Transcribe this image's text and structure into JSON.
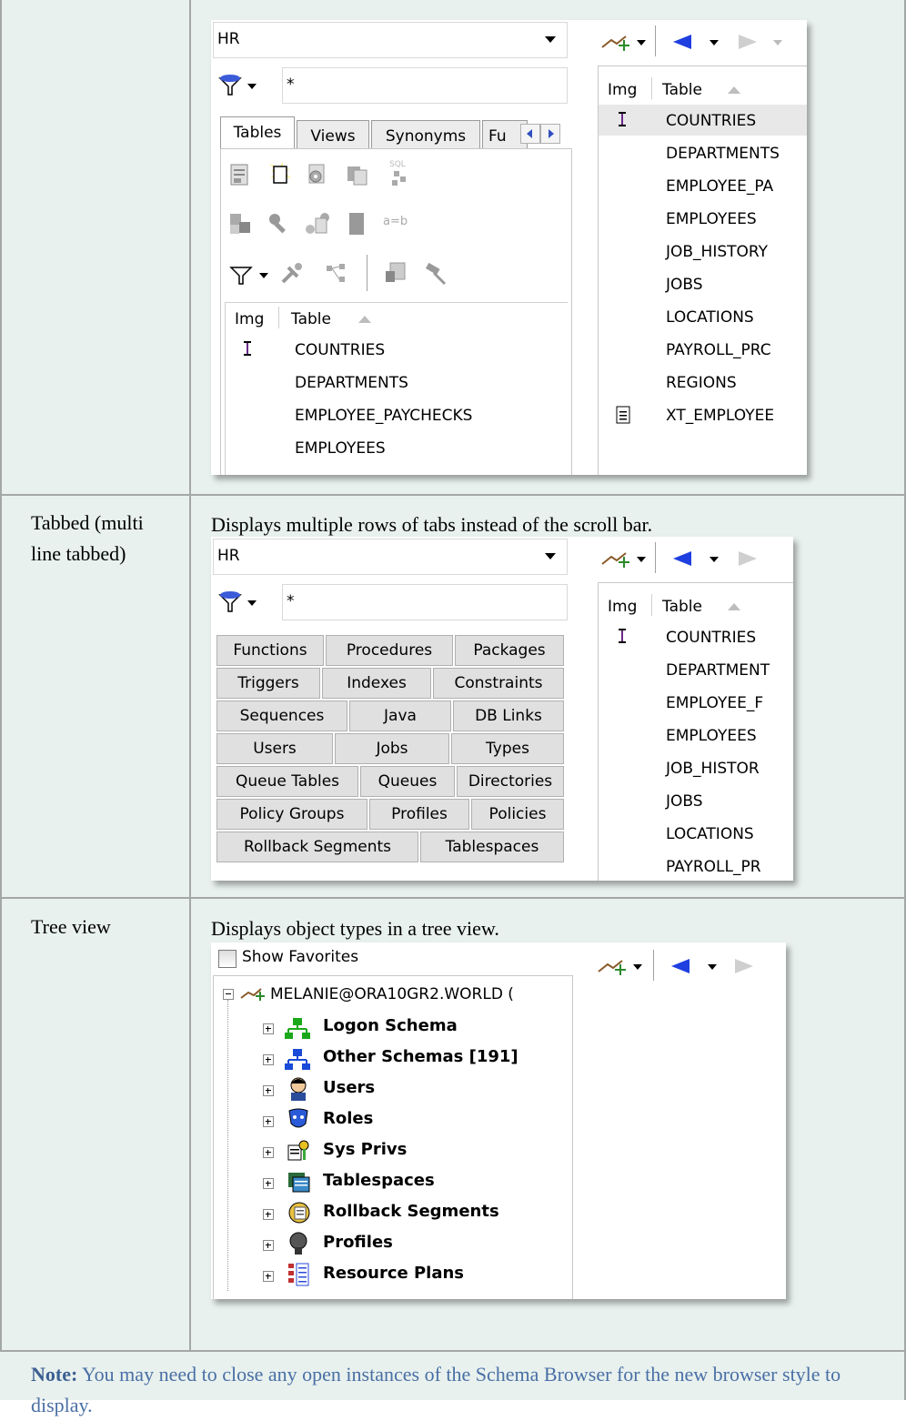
{
  "rows": [
    {
      "label": "",
      "description": ""
    },
    {
      "label": "Tabbed (multi line tabbed)",
      "description": "Displays multiple rows of tabs instead of the scroll bar."
    },
    {
      "label": "Tree view",
      "description": "Displays object types in a tree view."
    }
  ],
  "note": {
    "prefix": "Note:",
    "text": "You may need to close any open instances of the Schema Browser for the new browser style to display."
  },
  "shot1": {
    "schema": "HR",
    "filter": "*",
    "tabs": [
      "Tables",
      "Views",
      "Synonyms",
      "Fu"
    ],
    "grid_headers": {
      "img": "Img",
      "table": "Table"
    },
    "tables": [
      "COUNTRIES",
      "DEPARTMENTS",
      "EMPLOYEE_PAYCHECKS",
      "EMPLOYEES"
    ],
    "sql_label": "SQL",
    "ab_label": "a=b",
    "right_tables": [
      "COUNTRIES",
      "DEPARTMENTS",
      "EMPLOYEE_PA",
      "EMPLOYEES",
      "JOB_HISTORY",
      "JOBS",
      "LOCATIONS",
      "PAYROLL_PRC",
      "REGIONS",
      "XT_EMPLOYEE"
    ]
  },
  "shot2": {
    "schema": "HR",
    "filter": "*",
    "tab_rows": [
      [
        "Functions",
        "Procedures",
        "Packages"
      ],
      [
        "Triggers",
        "Indexes",
        "Constraints"
      ],
      [
        "Sequences",
        "Java",
        "DB Links"
      ],
      [
        "Users",
        "Jobs",
        "Types"
      ],
      [
        "Queue Tables",
        "Queues",
        "Directories"
      ],
      [
        "Policy Groups",
        "Profiles",
        "Policies"
      ],
      [
        "Rollback Segments",
        "Tablespaces"
      ]
    ],
    "grid_headers": {
      "img": "Img",
      "table": "Table"
    },
    "right_tables": [
      "COUNTRIES",
      "DEPARTMENT",
      "EMPLOYEE_F",
      "EMPLOYEES",
      "JOB_HISTOR",
      "JOBS",
      "LOCATIONS",
      "PAYROLL_PR"
    ]
  },
  "shot3": {
    "show_favorites": "Show Favorites",
    "root": "MELANIE@ORA10GR2.WORLD (",
    "items": [
      "Logon Schema",
      "Other Schemas [191]",
      "Users",
      "Roles",
      "Sys Privs",
      "Tablespaces",
      "Rollback Segments",
      "Profiles",
      "Resource Plans"
    ]
  },
  "colors": {
    "cell_bg": "#e8f1ee",
    "grid_line": "#a3a8a6",
    "note_text": "#4a6fa5"
  }
}
